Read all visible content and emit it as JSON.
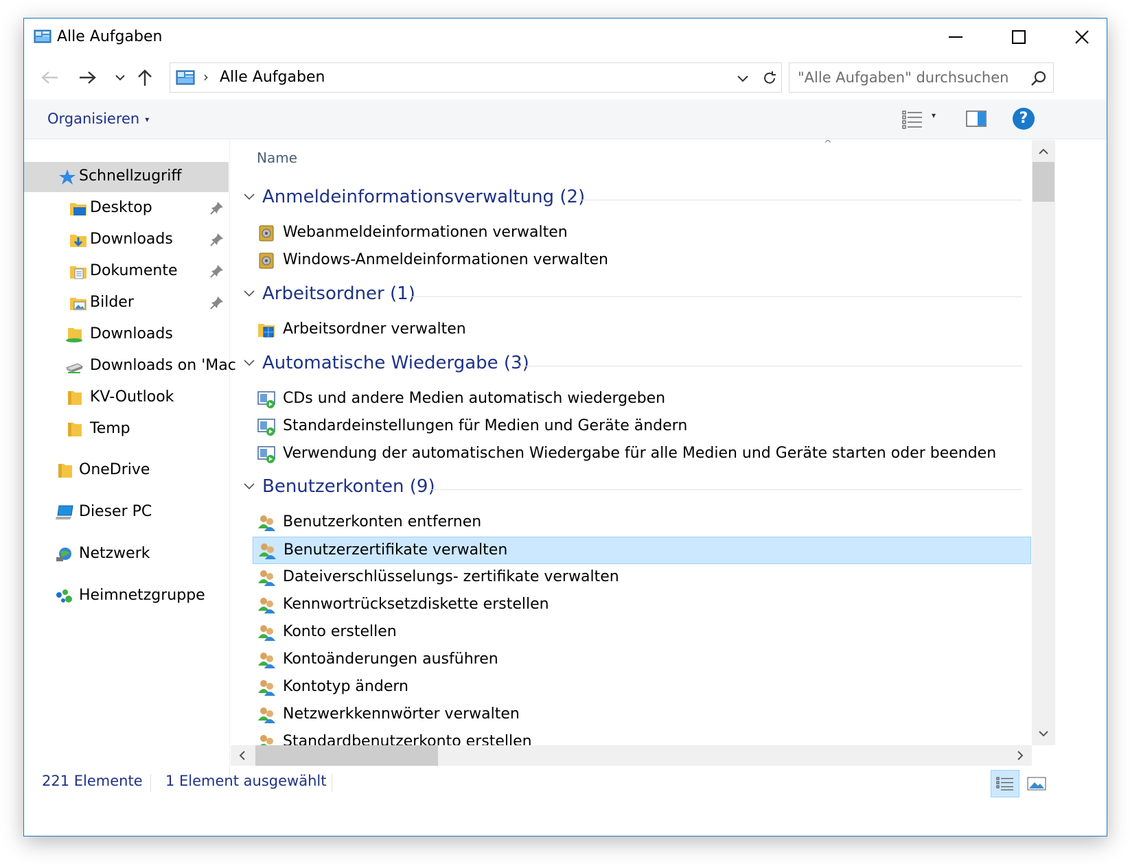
{
  "window": {
    "title": "Alle Aufgaben",
    "accent": "#1979ca"
  },
  "address": {
    "breadcrumb": "Alle Aufgaben",
    "separator": "›"
  },
  "search": {
    "placeholder": "\"Alle Aufgaben\" durchsuchen"
  },
  "command": {
    "organize_label": "Organisieren",
    "help_label": "?"
  },
  "nav": {
    "quick_access": "Schnellzugriff",
    "items": [
      {
        "label": "Desktop",
        "icon": "desktop-folder-icon",
        "pinned": true
      },
      {
        "label": "Downloads",
        "icon": "downloads-folder-icon",
        "pinned": true
      },
      {
        "label": "Dokumente",
        "icon": "documents-folder-icon",
        "pinned": true
      },
      {
        "label": "Bilder",
        "icon": "pictures-folder-icon",
        "pinned": true
      },
      {
        "label": "Downloads",
        "icon": "downloads-green-folder-icon",
        "pinned": false
      },
      {
        "label": "Downloads on 'Mac",
        "icon": "network-drive-icon",
        "pinned": false
      },
      {
        "label": "KV-Outlook",
        "icon": "folder-icon",
        "pinned": false
      },
      {
        "label": "Temp",
        "icon": "folder-icon",
        "pinned": false
      }
    ],
    "onedrive": "OneDrive",
    "this_pc": "Dieser PC",
    "network": "Netzwerk",
    "homegroup": "Heimnetzgruppe"
  },
  "content": {
    "column_header": "Name",
    "sort_indicator": "^",
    "groups": [
      {
        "title": "Anmeldeinformationsverwaltung (2)",
        "icon": "credential-vault-icon",
        "items": [
          "Webanmeldeinformationen verwalten",
          "Windows-Anmeldeinformationen verwalten"
        ]
      },
      {
        "title": "Arbeitsordner (1)",
        "icon": "work-folders-icon",
        "items": [
          "Arbeitsordner verwalten"
        ]
      },
      {
        "title": "Automatische Wiedergabe (3)",
        "icon": "autoplay-icon",
        "items": [
          "CDs und andere Medien automatisch wiedergeben",
          "Standardeinstellungen für Medien und Geräte ändern",
          "Verwendung der automatischen Wiedergabe für alle Medien und Geräte starten oder beenden"
        ]
      },
      {
        "title": "Benutzerkonten (9)",
        "icon": "user-accounts-icon",
        "items": [
          "Benutzerkonten entfernen",
          "Benutzerzertifikate verwalten",
          "Dateiverschlüsselungs- zertifikate verwalten",
          "Kennwortrücksetzdiskette erstellen",
          "Konto erstellen",
          "Kontoänderungen ausführen",
          "Kontotyp ändern",
          "Netzwerkkennwörter verwalten",
          "Standardbenutzerkonto erstellen"
        ],
        "selected_item": "Benutzerzertifikate verwalten"
      }
    ]
  },
  "status": {
    "count": "221 Elemente",
    "selection": "1 Element ausgewählt"
  },
  "colors": {
    "link_blue": "#1e3287",
    "selection_bg": "#cce8ff",
    "selection_border": "#99d1ff",
    "nav_selected": "#d9d9d9"
  }
}
